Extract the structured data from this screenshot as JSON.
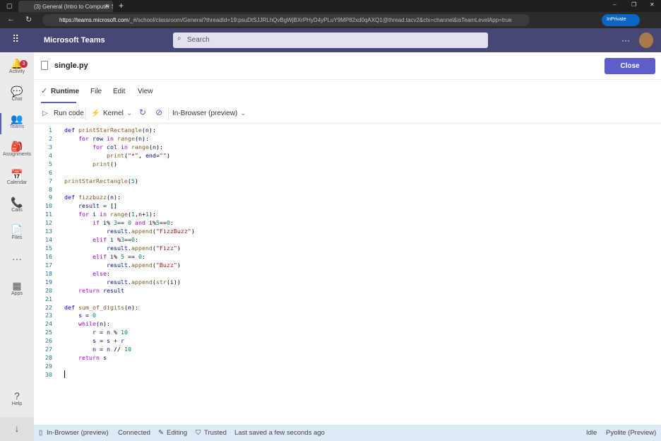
{
  "browser": {
    "tab_title": "(3) General (Intro to Computer S",
    "url_host": "https://teams.microsoft.com",
    "url_rest": "/_#/school/classroom/General?threadId=19:psuDtSJJRLhQvBgWjBXrPHyD4yPLuY9MP82xd0qAXQ1@thread.tacv2&ctx=channel&isTeamLevelApp=true",
    "inprivate": "InPrivate"
  },
  "header": {
    "app_name": "Microsoft Teams",
    "search_placeholder": "Search",
    "more": "···"
  },
  "rail": [
    {
      "label": "Activity",
      "icon": "🔔",
      "badge": "3"
    },
    {
      "label": "Chat",
      "icon": "💬"
    },
    {
      "label": "Teams",
      "icon": "👥",
      "active": true
    },
    {
      "label": "Assignments",
      "icon": "🎒"
    },
    {
      "label": "Calendar",
      "icon": "📅"
    },
    {
      "label": "Calls",
      "icon": "📞"
    },
    {
      "label": "Files",
      "icon": "📄"
    },
    {
      "label": "",
      "icon": "···"
    },
    {
      "label": "Apps",
      "icon": "▦"
    }
  ],
  "rail_bottom": {
    "help": "Help",
    "download": "↓"
  },
  "file": {
    "name": "single.py",
    "close": "Close"
  },
  "menus": {
    "runtime": "Runtime",
    "file": "File",
    "edit": "Edit",
    "view": "View"
  },
  "toolbar": {
    "run": "Run code",
    "kernel": "Kernel",
    "env": "In-Browser (preview)"
  },
  "code": [
    "def printStarRectangle(n):",
    "    for row in range(n):",
    "        for col in range(n):",
    "            print(\"*\", end=\"\")",
    "        print()",
    "",
    "printStarRectangle(5)",
    "",
    "def fizzbuzz(n):",
    "    result = []",
    "    for i in range(1,n+1):",
    "        if i% 3== 0 and i%5==0:",
    "            result.append(\"FizzBuzz\")",
    "        elif i %3==0:",
    "            result.append(\"Fizz\")",
    "        elif i% 5 == 0:",
    "            result.append(\"Buzz\")",
    "        else:",
    "            result.append(str(i))",
    "    return result",
    "",
    "def sum_of_digits(n):",
    "    s = 0",
    "    while(n):",
    "        r = n % 10",
    "        s = s + r",
    "        n = n // 10",
    "    return s",
    "",
    ""
  ],
  "status": {
    "env": "In-Browser (preview)",
    "conn": "Connected",
    "editing": "Editing",
    "trusted": "Trusted",
    "saved": "Last saved a few seconds ago",
    "kernel_state": "Idle",
    "kernel": "Pyolite (Preview)"
  },
  "colors": {
    "accent": "#5b5fc7",
    "header": "#464775"
  }
}
